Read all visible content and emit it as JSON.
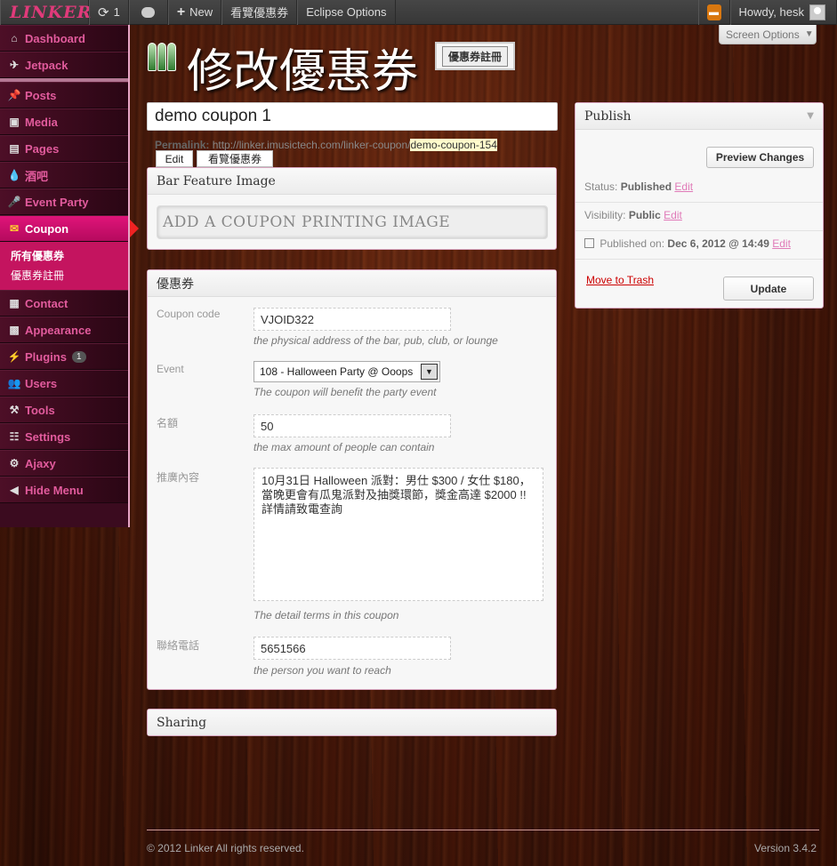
{
  "adminbar": {
    "logo": "LINKER",
    "updates_count": "1",
    "new_label": "New",
    "view_label": "看覽優惠券",
    "options_label": "Eclipse Options",
    "howdy": "Howdy, hesk"
  },
  "screen_options": "Screen Options",
  "menu": {
    "items": [
      {
        "label": "Dashboard",
        "icon": "dashboard-icon"
      },
      {
        "label": "Jetpack",
        "icon": "jetpack-icon"
      },
      {
        "label": "Posts",
        "icon": "pin-icon"
      },
      {
        "label": "Media",
        "icon": "media-icon"
      },
      {
        "label": "Pages",
        "icon": "pages-icon"
      },
      {
        "label": "酒吧",
        "icon": "drop-icon"
      },
      {
        "label": "Event Party",
        "icon": "microphone-icon"
      },
      {
        "label": "Coupon",
        "icon": "ticket-icon"
      },
      {
        "label": "Contact",
        "icon": "contact-icon"
      },
      {
        "label": "Appearance",
        "icon": "appearance-icon"
      },
      {
        "label": "Plugins",
        "icon": "plug-icon",
        "badge": "1"
      },
      {
        "label": "Users",
        "icon": "users-icon"
      },
      {
        "label": "Tools",
        "icon": "tools-icon"
      },
      {
        "label": "Settings",
        "icon": "settings-icon"
      },
      {
        "label": "Ajaxy",
        "icon": "gear-icon"
      },
      {
        "label": "Hide Menu",
        "icon": "hide-icon"
      }
    ],
    "submenu": [
      "所有優惠券",
      "優惠券註冊"
    ]
  },
  "header": {
    "title": "修改優惠券",
    "add_new": "優惠券註冊"
  },
  "post": {
    "title": "demo coupon 1",
    "permalink_label": "Permalink:",
    "permalink_base": "http://linker.imusictech.com/linker-coupon/",
    "permalink_slug": "demo-coupon-154",
    "edit_btn": "Edit",
    "view_btn": "看覽優惠券"
  },
  "image_box": {
    "title": "Bar Feature Image",
    "placeholder": "ADD A COUPON PRINTING IMAGE"
  },
  "coupon_box": {
    "title": "優惠券",
    "code_label": "Coupon code",
    "code_value": "VJOID322",
    "code_hint": "the physical address of the bar, pub, club, or lounge",
    "event_label": "Event",
    "event_value": "108 - Halloween Party @ Ooops",
    "event_hint": "The coupon will benefit the party event",
    "quota_label": "名額",
    "quota_value": "50",
    "quota_hint": "the max amount of people can contain",
    "detail_label": "推廣內容",
    "detail_value": "10月31日 Halloween 派對：男仕 $300 / 女仕 $180，當晚更會有瓜鬼派對及抽獎環節，獎金高達 $2000 !! 詳情請致電查詢",
    "detail_hint": "The detail terms in this coupon",
    "phone_label": "聯絡電話",
    "phone_value": "5651566",
    "phone_hint": "the person you want to reach"
  },
  "sharing_box": {
    "title": "Sharing"
  },
  "publish": {
    "title": "Publish",
    "preview": "Preview Changes",
    "status_label": "Status:",
    "status_value": "Published",
    "visibility_label": "Visibility:",
    "visibility_value": "Public",
    "published_label": "Published on:",
    "published_value": "Dec 6, 2012 @ 14:49",
    "edit_link": "Edit",
    "trash": "Move to Trash",
    "update": "Update"
  },
  "footer": {
    "copyright": "© 2012 Linker All rights reserved.",
    "version": "Version 3.4.2"
  }
}
